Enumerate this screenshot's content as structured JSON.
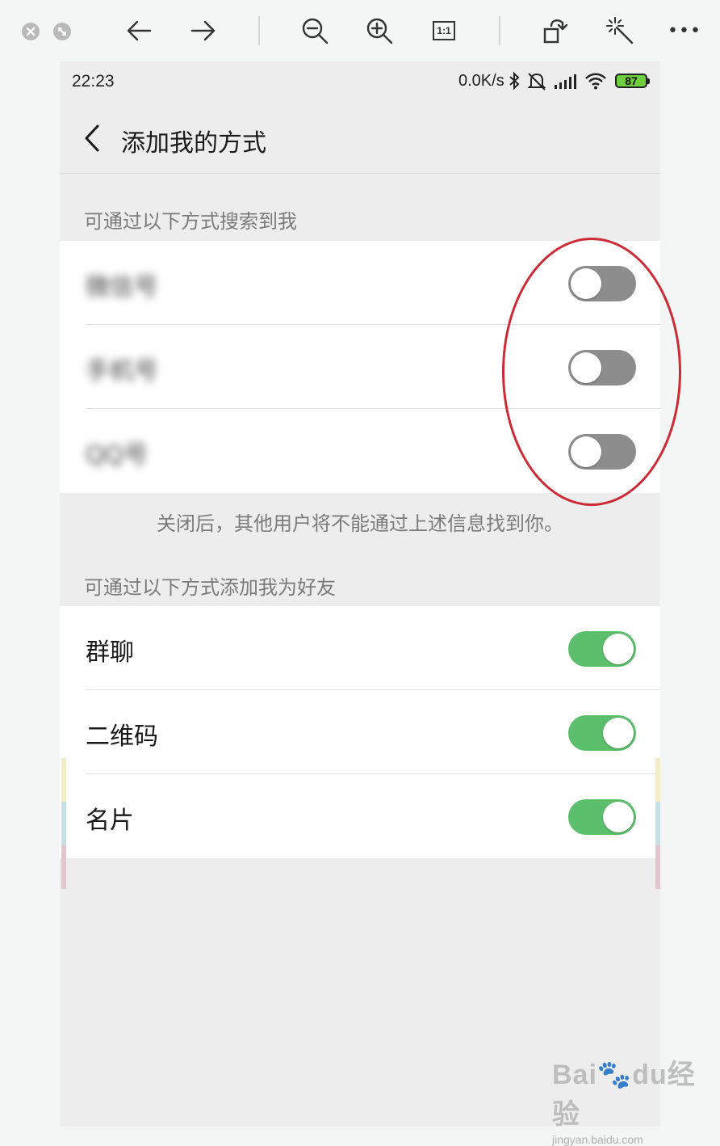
{
  "viewer": {
    "toolbar_icons": [
      "close-icon",
      "fullscreen-icon",
      "back-arrow-icon",
      "forward-arrow-icon",
      "zoom-out-icon",
      "zoom-in-icon",
      "actual-size-icon",
      "rotate-icon",
      "magic-wand-icon",
      "more-icon"
    ],
    "actual_size_glyph": "1:1",
    "more_glyph": "•••"
  },
  "statusbar": {
    "time": "22:23",
    "net_speed": "0.0K/s",
    "battery": "87"
  },
  "navbar": {
    "back_glyph": "‹",
    "title": "添加我的方式"
  },
  "search_section": {
    "label": "可通过以下方式搜索到我",
    "items": [
      {
        "label": "微信号",
        "enabled": false
      },
      {
        "label": "手机号",
        "enabled": false
      },
      {
        "label": "QQ号",
        "enabled": false
      }
    ],
    "hint": "关闭后，其他用户将不能通过上述信息找到你。"
  },
  "add_section": {
    "label": "可通过以下方式添加我为好友",
    "items": [
      {
        "label": "群聊",
        "enabled": true
      },
      {
        "label": "二维码",
        "enabled": true
      },
      {
        "label": "名片",
        "enabled": true
      }
    ]
  },
  "colors": {
    "toggle_on": "#5bbf6c",
    "toggle_off": "#8d8d8d",
    "annotation": "#cc2a35",
    "background": "#ededed"
  },
  "watermark": {
    "main": "Bai🐾du经验",
    "sub": "jingyan.baidu.com"
  }
}
